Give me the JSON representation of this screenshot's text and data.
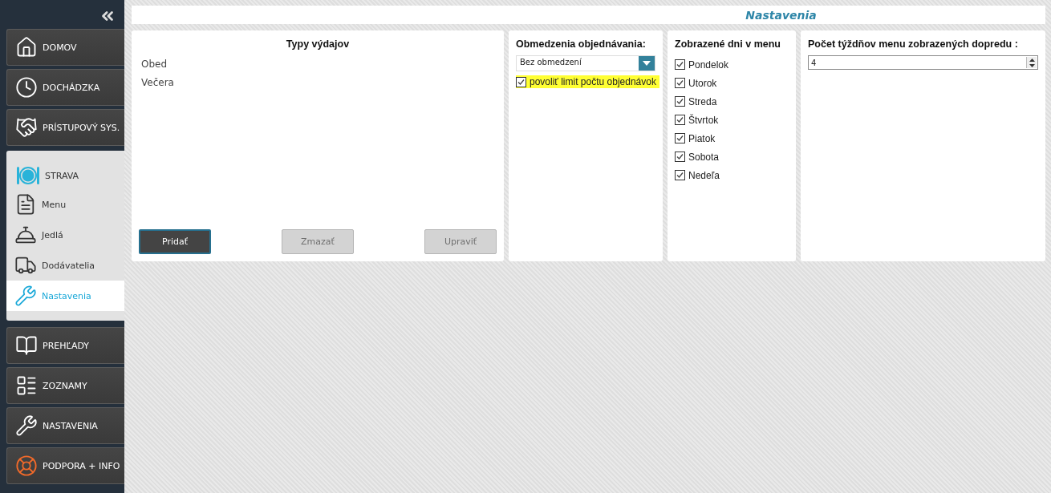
{
  "sidebar": {
    "items": [
      {
        "label": "DOMOV",
        "kind": "main"
      },
      {
        "label": "DOCHÁDZKA",
        "kind": "main"
      },
      {
        "label": "PRÍSTUPOVÝ SYS.",
        "kind": "main"
      },
      {
        "label": "STRAVA",
        "kind": "group",
        "children": [
          {
            "label": "Menu",
            "selected": false
          },
          {
            "label": "Jedlá",
            "selected": false
          },
          {
            "label": "Dodávatelia",
            "selected": false
          },
          {
            "label": "Nastavenia",
            "selected": true
          }
        ]
      },
      {
        "label": "PREHĽADY",
        "kind": "main"
      },
      {
        "label": "ZOZNAMY",
        "kind": "main"
      },
      {
        "label": "NASTAVENIA",
        "kind": "main"
      },
      {
        "label": "PODPORA + INFO",
        "kind": "main"
      }
    ]
  },
  "header": {
    "title": "Nastavenia"
  },
  "expense_types": {
    "title": "Typy výdajov",
    "items": [
      "Obed",
      "Večera"
    ],
    "buttons": [
      {
        "label": "Pridať",
        "disabled": false
      },
      {
        "label": "Zmazať",
        "disabled": true
      },
      {
        "label": "Upraviť",
        "disabled": true
      }
    ]
  },
  "order_limits": {
    "title": "Obmedzenia objednávania:",
    "dropdown": {
      "value": "Bez obmedzení"
    },
    "limit_checkbox": {
      "label": "povoliť limit počtu objednávok",
      "checked": true
    }
  },
  "menu_days": {
    "title": "Zobrazené dni v menu",
    "days": [
      {
        "label": "Pondelok",
        "checked": true
      },
      {
        "label": "Utorok",
        "checked": true
      },
      {
        "label": "Streda",
        "checked": true
      },
      {
        "label": "Štvrtok",
        "checked": true
      },
      {
        "label": "Piatok",
        "checked": true
      },
      {
        "label": "Sobota",
        "checked": true
      },
      {
        "label": "Nedeľa",
        "checked": true
      }
    ]
  },
  "weeks_ahead": {
    "title": "Počet týždňov menu zobrazených dopredu :",
    "value": "4"
  }
}
